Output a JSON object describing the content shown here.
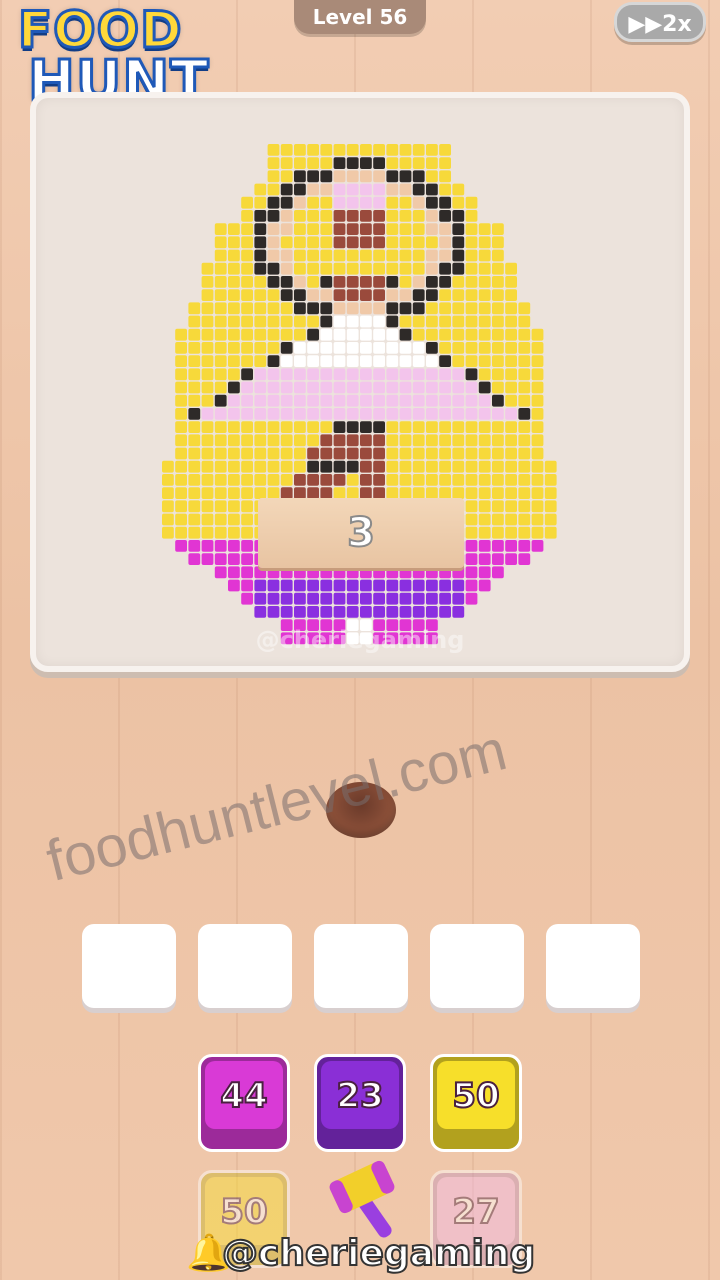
{
  "header": {
    "logo_line1": "FOOD",
    "logo_line2": "HUNT",
    "level_label": "Level 56",
    "speed_label": "▶▶2x"
  },
  "board": {
    "sign_count": "3",
    "watermark": "@cheriegaming"
  },
  "watermark_site": "foodhuntlevel.com",
  "slots_count": 5,
  "tiles": [
    {
      "label": "44",
      "color": "#d93ad6"
    },
    {
      "label": "23",
      "color": "#8a2fd6"
    },
    {
      "label": "50",
      "color": "#f7df2a"
    }
  ],
  "tiles_back": [
    {
      "label": "50",
      "color": "#f7df2a"
    },
    {
      "label": "27",
      "color": "#f2b8ea"
    }
  ],
  "powerup": "hammer-icon",
  "footer": {
    "bell": "🔔",
    "handle": "@cheriegaming"
  },
  "colors": {
    "yellow": "#f7d93a",
    "magenta": "#e135d3",
    "purple": "#8a2fe0",
    "white": "#ffffff",
    "pink": "#f3c4ec",
    "brown": "#9a4a3c",
    "tan": "#f0c9a8",
    "black": "#2e2a28"
  }
}
